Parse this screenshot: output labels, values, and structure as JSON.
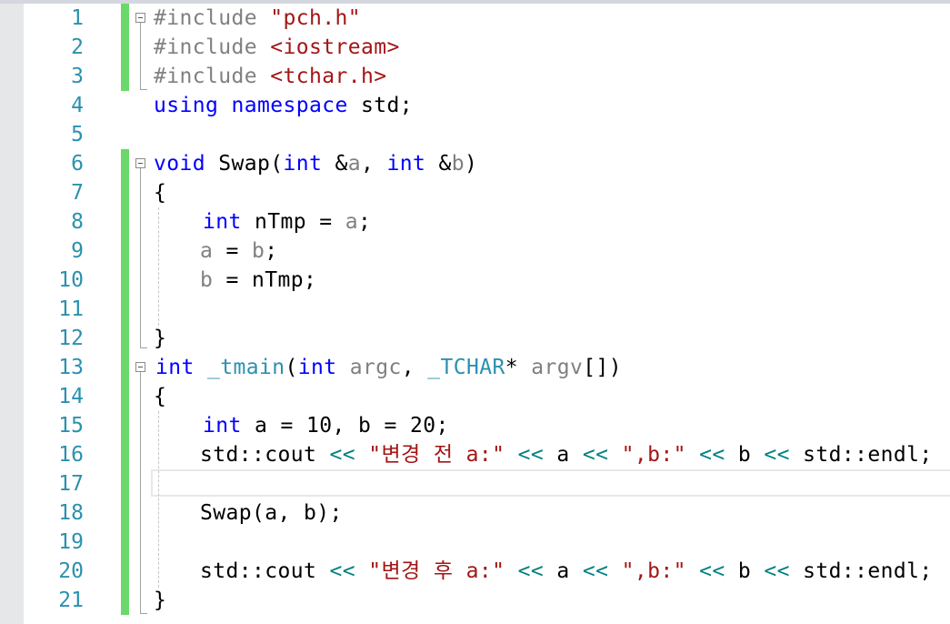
{
  "editor": {
    "line_numbers": [
      "1",
      "2",
      "3",
      "4",
      "5",
      "6",
      "7",
      "8",
      "9",
      "10",
      "11",
      "12",
      "13",
      "14",
      "15",
      "16",
      "17",
      "18",
      "19",
      "20",
      "21"
    ],
    "current_line": 17,
    "colors": {
      "keyword": "#0000ff",
      "string": "#a31515",
      "type": "#2b91af",
      "operator": "#008080",
      "preprocessor": "#808080",
      "parameter": "#808080",
      "change_bar": "#6ad86a"
    },
    "lines": {
      "l1": {
        "a": "#include ",
        "b": "\"pch.h\""
      },
      "l2": {
        "a": "#include ",
        "b": "<iostream>"
      },
      "l3": {
        "a": "#include ",
        "b": "<tchar.h>"
      },
      "l4": {
        "a": "using",
        "b": " ",
        "c": "namespace",
        "d": " std;"
      },
      "l6": {
        "a": "void",
        "b": " Swap(",
        "c": "int",
        "d": " &",
        "e": "a",
        "f": ", ",
        "g": "int",
        "h": " &",
        "i": "b",
        "j": ")"
      },
      "l7": {
        "a": "{"
      },
      "l8": {
        "a": "int",
        "b": " nTmp = ",
        "c": "a",
        "d": ";"
      },
      "l9": {
        "a": "a",
        "b": " = ",
        "c": "b",
        "d": ";"
      },
      "l10": {
        "a": "b",
        "b": " = nTmp;"
      },
      "l12": {
        "a": "}"
      },
      "l13": {
        "a": "int",
        "b": " ",
        "c": "_tmain",
        "d": "(",
        "e": "int",
        "f": " ",
        "g": "argc",
        "h": ", ",
        "i": "_TCHAR",
        "j": "* ",
        "k": "argv",
        "l": "[])"
      },
      "l14": {
        "a": "{"
      },
      "l15": {
        "a": "int",
        "b": " a = 10, b = 20;"
      },
      "l16": {
        "a": "std::cout ",
        "b": "<<",
        "c": " ",
        "d": "\"변경 전 a:\"",
        "e": " ",
        "f": "<<",
        "g": " a ",
        "h": "<<",
        "i": " ",
        "j": "\",b:\"",
        "k": " ",
        "l": "<<",
        "m": " b ",
        "n": "<<",
        "o": " std::endl;"
      },
      "l18": {
        "a": "Swap(a, b);"
      },
      "l20": {
        "a": "std::cout ",
        "b": "<<",
        "c": " ",
        "d": "\"변경 후 a:\"",
        "e": " ",
        "f": "<<",
        "g": " a ",
        "h": "<<",
        "i": " ",
        "j": "\",b:\"",
        "k": " ",
        "l": "<<",
        "m": " b ",
        "n": "<<",
        "o": " std::endl;"
      },
      "l21": {
        "a": "}"
      }
    }
  }
}
